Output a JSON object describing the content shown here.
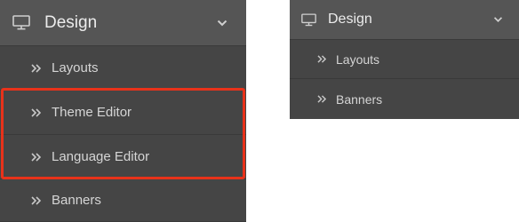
{
  "left_menu": {
    "title": "Design",
    "icon": "monitor-icon",
    "expand_icon": "chevron-down-icon",
    "items": [
      {
        "label": "Layouts",
        "icon": "double-chevron-right-icon"
      },
      {
        "label": "Theme Editor",
        "icon": "double-chevron-right-icon"
      },
      {
        "label": "Language Editor",
        "icon": "double-chevron-right-icon"
      },
      {
        "label": "Banners",
        "icon": "double-chevron-right-icon"
      }
    ],
    "highlighted_items": [
      "Theme Editor",
      "Language Editor"
    ],
    "highlight_color": "#e8321a"
  },
  "right_menu": {
    "title": "Design",
    "icon": "monitor-icon",
    "expand_icon": "chevron-down-icon",
    "items": [
      {
        "label": "Layouts",
        "icon": "double-chevron-right-icon"
      },
      {
        "label": "Banners",
        "icon": "double-chevron-right-icon"
      }
    ]
  },
  "colors": {
    "panel_background": "#454545",
    "header_background": "#555555",
    "text": "#d5d5d5"
  }
}
